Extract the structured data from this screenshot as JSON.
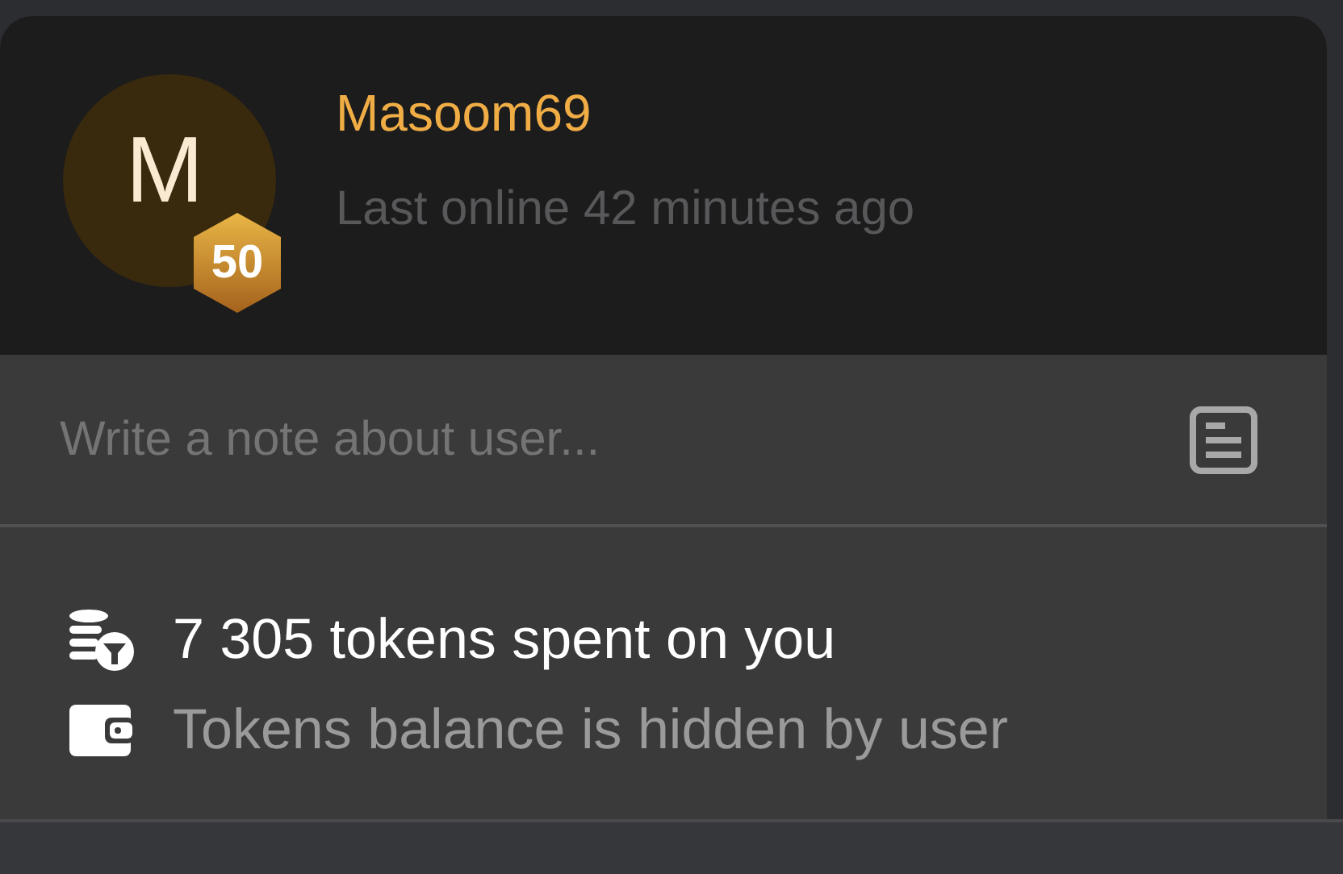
{
  "profile": {
    "avatar_letter": "M",
    "level": "50",
    "username": "Masoom69",
    "last_online": "Last online 42 minutes ago"
  },
  "note": {
    "placeholder": "Write a note about user..."
  },
  "stats": [
    {
      "kind": "spent",
      "text": "7 305 tokens spent on you"
    },
    {
      "kind": "balance",
      "text": "Tokens balance is hidden by user"
    }
  ]
}
